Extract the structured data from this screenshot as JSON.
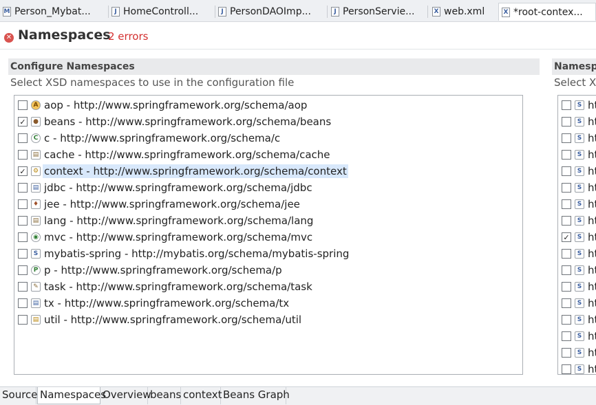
{
  "editor_tabs": [
    {
      "label": "Person_Mybat...",
      "icon": "M",
      "active": false
    },
    {
      "label": "HomeControll...",
      "icon": "J",
      "active": false
    },
    {
      "label": "PersonDAOImp...",
      "icon": "J",
      "active": false
    },
    {
      "label": "PersonServie...",
      "icon": "J",
      "active": false
    },
    {
      "label": "web.xml",
      "icon": "X",
      "active": false
    },
    {
      "label": "*root-contex...",
      "icon": "X",
      "active": true
    }
  ],
  "header": {
    "title": "Namespaces",
    "error_count": "2 errors",
    "error_color": "#d32f2f"
  },
  "left_section": {
    "title": "Configure Namespaces",
    "description": "Select XSD namespaces to use in the configuration file",
    "namespaces": [
      {
        "label": "aop - http://www.springframework.org/schema/aop",
        "checked": false,
        "icon": "aop-icon"
      },
      {
        "label": "beans - http://www.springframework.org/schema/beans",
        "checked": true,
        "icon": "beans-icon"
      },
      {
        "label": "c - http://www.springframework.org/schema/c",
        "checked": false,
        "icon": "c-icon"
      },
      {
        "label": "cache - http://www.springframework.org/schema/cache",
        "checked": false,
        "icon": "cache-icon"
      },
      {
        "label": "context - http://www.springframework.org/schema/context",
        "checked": true,
        "icon": "context-icon",
        "selected": true
      },
      {
        "label": "jdbc - http://www.springframework.org/schema/jdbc",
        "checked": false,
        "icon": "jdbc-icon"
      },
      {
        "label": "jee - http://www.springframework.org/schema/jee",
        "checked": false,
        "icon": "jee-icon"
      },
      {
        "label": "lang - http://www.springframework.org/schema/lang",
        "checked": false,
        "icon": "lang-icon"
      },
      {
        "label": "mvc - http://www.springframework.org/schema/mvc",
        "checked": false,
        "icon": "mvc-icon"
      },
      {
        "label": "mybatis-spring - http://mybatis.org/schema/mybatis-spring",
        "checked": false,
        "icon": "mybatis-icon"
      },
      {
        "label": "p - http://www.springframework.org/schema/p",
        "checked": false,
        "icon": "p-icon"
      },
      {
        "label": "task - http://www.springframework.org/schema/task",
        "checked": false,
        "icon": "task-icon"
      },
      {
        "label": "tx - http://www.springframework.org/schema/tx",
        "checked": false,
        "icon": "tx-icon"
      },
      {
        "label": "util - http://www.springframework.org/schema/util",
        "checked": false,
        "icon": "util-icon"
      }
    ]
  },
  "right_section": {
    "title": "Namespa",
    "description": "Select XS",
    "rows": [
      {
        "label": "ht",
        "checked": false
      },
      {
        "label": "ht",
        "checked": false
      },
      {
        "label": "ht",
        "checked": false
      },
      {
        "label": "ht",
        "checked": false
      },
      {
        "label": "ht",
        "checked": false
      },
      {
        "label": "ht",
        "checked": false
      },
      {
        "label": "ht",
        "checked": false
      },
      {
        "label": "ht",
        "checked": false
      },
      {
        "label": "ht",
        "checked": true
      },
      {
        "label": "ht",
        "checked": false
      },
      {
        "label": "ht",
        "checked": false
      },
      {
        "label": "ht",
        "checked": false
      },
      {
        "label": "ht",
        "checked": false
      },
      {
        "label": "ht",
        "checked": false
      },
      {
        "label": "ht",
        "checked": false
      },
      {
        "label": "ht",
        "checked": false
      },
      {
        "label": "ht",
        "checked": false
      }
    ]
  },
  "bottom_tabs": [
    {
      "label": "Source",
      "active": false
    },
    {
      "label": "Namespaces",
      "active": true
    },
    {
      "label": "Overview",
      "active": false
    },
    {
      "label": "beans",
      "active": false
    },
    {
      "label": "context",
      "active": false
    },
    {
      "label": "Beans Graph",
      "active": false
    }
  ],
  "colors": {
    "selection": "#d8e8fb",
    "error": "#d32f2f"
  }
}
